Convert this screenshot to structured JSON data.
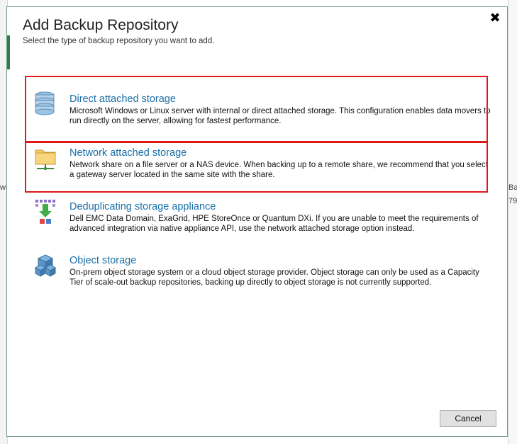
{
  "background": {
    "left_fragment_text": "ws",
    "right_fragment_text_1": "Ba",
    "right_fragment_text_2": "79"
  },
  "dialog": {
    "title": "Add Backup Repository",
    "subtitle": "Select the type of backup repository you want to add.",
    "close_icon": "✖",
    "cancel_label": "Cancel"
  },
  "options": [
    {
      "icon": "database-stack-icon",
      "title": "Direct attached storage",
      "description": "Microsoft Windows or Linux server with internal or direct attached storage. This configuration enables data movers to run directly on the server, allowing for fastest performance."
    },
    {
      "icon": "network-folder-icon",
      "title": "Network attached storage",
      "description": "Network share on a file server or a NAS device. When backing up to a remote share, we recommend that you select a gateway server located in the same site with the share."
    },
    {
      "icon": "dedup-appliance-icon",
      "title": "Deduplicating storage appliance",
      "description": "Dell EMC Data Domain, ExaGrid, HPE StoreOnce or Quantum DXi. If you are unable to meet the requirements of advanced integration via native appliance API, use the network attached storage option instead."
    },
    {
      "icon": "object-storage-cubes-icon",
      "title": "Object storage",
      "description": "On-prem object storage system or a cloud object storage provider. Object storage can only be used as a Capacity Tier of scale-out backup repositories, backing up directly to object storage is not currently supported."
    }
  ],
  "colors": {
    "accent": "#2e7d4f",
    "link": "#1a6fa8",
    "highlight": "#e01919"
  }
}
